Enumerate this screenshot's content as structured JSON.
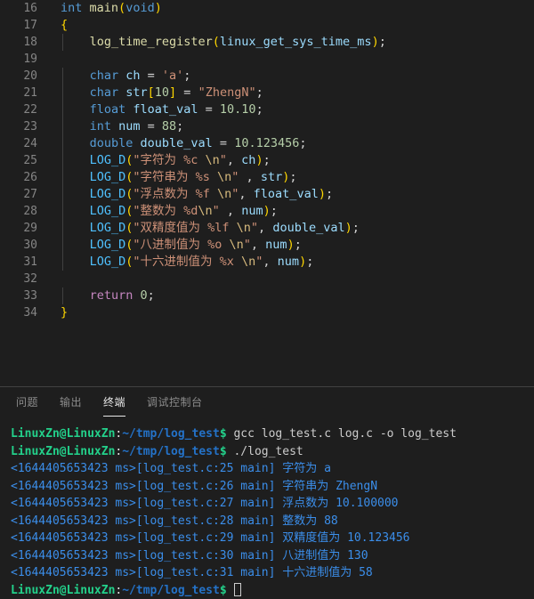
{
  "editor": {
    "first_line_number": 16,
    "lines": [
      {
        "n": 16,
        "text": "int main(void)"
      },
      {
        "n": 17,
        "text": "{"
      },
      {
        "n": 18,
        "text": "    log_time_register(linux_get_sys_time_ms);"
      },
      {
        "n": 19,
        "text": ""
      },
      {
        "n": 20,
        "text": "    char ch = 'a';"
      },
      {
        "n": 21,
        "text": "    char str[10] = \"ZhengN\";"
      },
      {
        "n": 22,
        "text": "    float float_val = 10.10;"
      },
      {
        "n": 23,
        "text": "    int num = 88;"
      },
      {
        "n": 24,
        "text": "    double double_val = 10.123456;"
      },
      {
        "n": 25,
        "text": "    LOG_D(\"字符为 %c \\n\", ch);"
      },
      {
        "n": 26,
        "text": "    LOG_D(\"字符串为 %s \\n\" , str);"
      },
      {
        "n": 27,
        "text": "    LOG_D(\"浮点数为 %f \\n\", float_val);"
      },
      {
        "n": 28,
        "text": "    LOG_D(\"整数为 %d\\n\" , num);"
      },
      {
        "n": 29,
        "text": "    LOG_D(\"双精度值为 %lf \\n\", double_val);"
      },
      {
        "n": 30,
        "text": "    LOG_D(\"八进制值为 %o \\n\", num);"
      },
      {
        "n": 31,
        "text": "    LOG_D(\"十六进制值为 %x \\n\", num);"
      },
      {
        "n": 32,
        "text": ""
      },
      {
        "n": 33,
        "text": "    return 0;"
      },
      {
        "n": 34,
        "text": "}"
      }
    ]
  },
  "panel": {
    "tabs": [
      {
        "label": "问题",
        "active": false
      },
      {
        "label": "输出",
        "active": false
      },
      {
        "label": "终端",
        "active": true
      },
      {
        "label": "调试控制台",
        "active": false
      }
    ]
  },
  "terminal": {
    "prompt": {
      "user_host": "LinuxZn@LinuxZn",
      "separator": ":",
      "path": "~/tmp/log_test",
      "symbol": "$"
    },
    "lines": [
      {
        "type": "command",
        "command": " gcc log_test.c log.c -o log_test"
      },
      {
        "type": "command",
        "command": " ./log_test"
      },
      {
        "type": "log",
        "text": "<1644405653423 ms>[log_test.c:25 main] 字符为 a"
      },
      {
        "type": "log",
        "text": "<1644405653423 ms>[log_test.c:26 main] 字符串为 ZhengN"
      },
      {
        "type": "log",
        "text": "<1644405653423 ms>[log_test.c:27 main] 浮点数为 10.100000"
      },
      {
        "type": "log",
        "text": "<1644405653423 ms>[log_test.c:28 main] 整数为 88"
      },
      {
        "type": "log",
        "text": "<1644405653423 ms>[log_test.c:29 main] 双精度值为 10.123456"
      },
      {
        "type": "log",
        "text": "<1644405653423 ms>[log_test.c:30 main] 八进制值为 130"
      },
      {
        "type": "log",
        "text": "<1644405653423 ms>[log_test.c:31 main] 十六进制值为 58"
      },
      {
        "type": "prompt_cursor",
        "command": " "
      }
    ]
  },
  "colors": {
    "editor_background": "#1e1e1e",
    "line_number": "#858585",
    "keyword": "#c586c0",
    "type": "#569cd6",
    "function": "#dcdcaa",
    "variable": "#9cdcfe",
    "string": "#ce9178",
    "escape": "#d7ba7d",
    "number": "#b5cea8",
    "macro": "#4fc1ff",
    "brace": "#ffd700",
    "terminal_green": "#23d18b",
    "terminal_blue": "#2472c8",
    "terminal_log_blue": "#3b8eea",
    "panel_border": "#424242",
    "tab_active": "#e7e7e7",
    "tab_inactive": "#8c8c8c"
  }
}
